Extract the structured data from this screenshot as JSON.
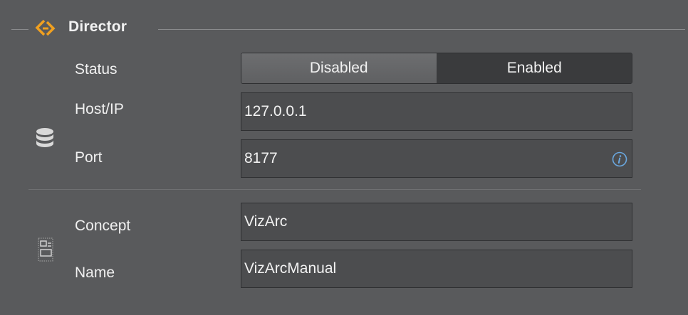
{
  "section": {
    "title": "Director",
    "icon": "director-logo-icon",
    "accent": "#f0a020"
  },
  "status": {
    "label": "Status",
    "options": [
      "Disabled",
      "Enabled"
    ],
    "selected": "Enabled"
  },
  "connection": {
    "icon": "database-icon",
    "host_label": "Host/IP",
    "host_value": "127.0.0.1",
    "port_label": "Port",
    "port_value": "8177",
    "port_info_icon": "info-icon"
  },
  "playlist": {
    "icon": "concept-icon",
    "concept_label": "Concept",
    "concept_value": "VizArc",
    "name_label": "Name",
    "name_value": "VizArcManual"
  }
}
